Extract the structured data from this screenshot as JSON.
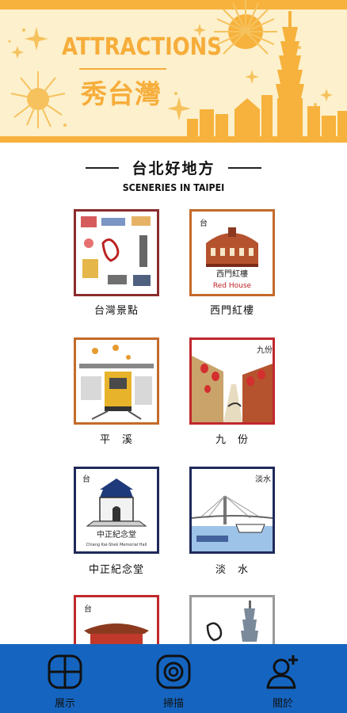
{
  "banner": {
    "title_en": "ATTRACTIONS",
    "title_zh": "秀台灣",
    "colors": {
      "background": "#fdf0cc",
      "accent": "#f6ad3a"
    }
  },
  "section": {
    "title": "台北好地方",
    "subtitle": "SCENERIES IN TAIPEI"
  },
  "attractions": [
    {
      "label": "台灣景點",
      "art_caption": "",
      "art_caption_en": "",
      "border": "#8b2c2c",
      "icon": "taiwan-collage-icon"
    },
    {
      "label": "西門紅樓",
      "art_caption": "西門紅樓",
      "art_caption_en": "Red House",
      "border": "#c46a2a",
      "icon": "red-house-icon"
    },
    {
      "label": "平　溪",
      "art_caption": "",
      "art_caption_en": "",
      "border": "#c46a2a",
      "icon": "pingxi-train-icon"
    },
    {
      "label": "九　份",
      "art_caption": "",
      "art_caption_en": "",
      "border": "#c0282c",
      "icon": "jiufen-street-icon"
    },
    {
      "label": "中正紀念堂",
      "art_caption": "中正紀念堂",
      "art_caption_en": "Chiang Kai-Shek Memorial Hall",
      "border": "#1f2a5a",
      "icon": "memorial-hall-icon"
    },
    {
      "label": "淡　水",
      "art_caption": "",
      "art_caption_en": "",
      "border": "#1f2a5a",
      "icon": "tamsui-bridge-icon"
    },
    {
      "label": "",
      "art_caption": "",
      "art_caption_en": "",
      "border": "#c0282c",
      "icon": "temple-icon"
    },
    {
      "label": "",
      "art_caption": "",
      "art_caption_en": "",
      "border": "#9a9a9a",
      "icon": "taipei101-icon"
    }
  ],
  "nav": {
    "items": [
      {
        "label": "展示",
        "icon": "grid-icon"
      },
      {
        "label": "掃描",
        "icon": "scan-icon"
      },
      {
        "label": "關於",
        "icon": "user-add-icon"
      }
    ],
    "colors": {
      "background": "#1565c0"
    }
  }
}
